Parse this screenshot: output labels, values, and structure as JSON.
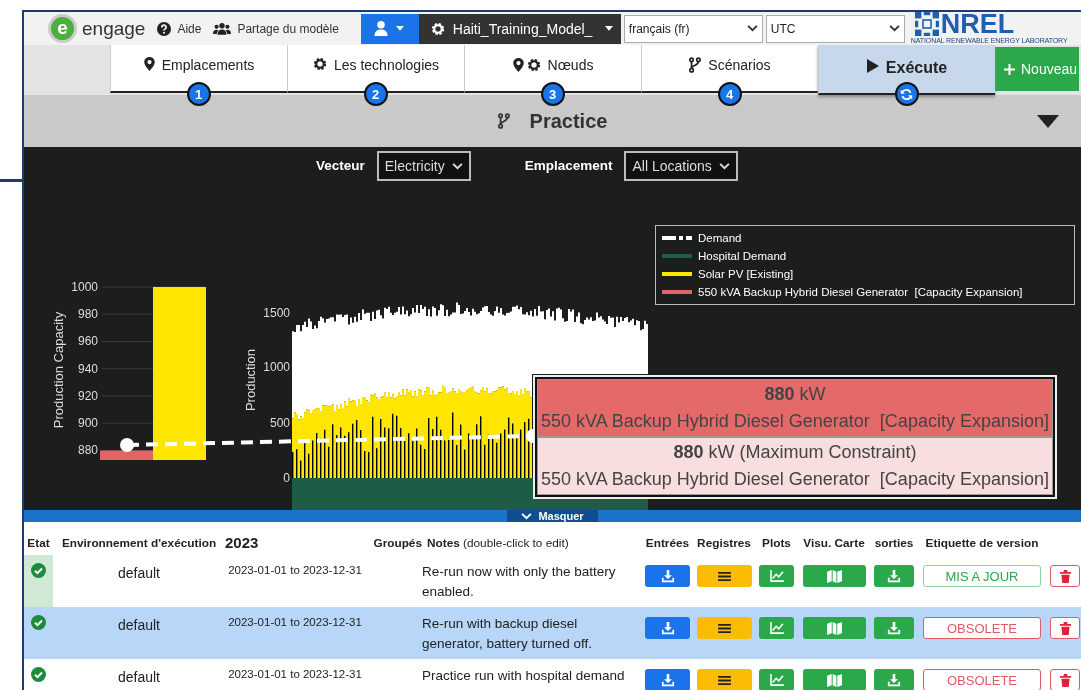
{
  "header": {
    "logo_letter": "e",
    "logo_text": "engage",
    "links": [
      {
        "label": "Aide"
      },
      {
        "label": "Partage du modèle"
      }
    ],
    "model": "Haiti_Training_Model_",
    "language": "français (fr)",
    "timezone": "UTC",
    "brand": "NREL",
    "brand_subtitle": "NATIONAL RENEWABLE ENERGY LABORATORY"
  },
  "nav": {
    "tabs": [
      {
        "label": "Emplacements",
        "badge": "1",
        "kind": "step",
        "selected": false
      },
      {
        "label": "Les technologies",
        "badge": "2",
        "kind": "step",
        "selected": false
      },
      {
        "label": "Nœuds",
        "badge": "3",
        "kind": "step",
        "selected": false
      },
      {
        "label": "Scénarios",
        "badge": "4",
        "kind": "step",
        "selected": false
      },
      {
        "label": "Exécute",
        "kind": "run",
        "selected": true
      }
    ],
    "new_button": "Nouveau"
  },
  "scenario": {
    "title": "Practice"
  },
  "filters": [
    {
      "label": "Vecteur",
      "value": "Electricity"
    },
    {
      "label": "Emplacement",
      "value": "All Locations"
    }
  ],
  "capacity_chart": {
    "chart_data": {
      "type": "bar",
      "ylabel": "Production Capacity",
      "ylim": [
        873,
        1000
      ],
      "yticks": [
        880,
        900,
        920,
        940,
        960,
        980,
        1000
      ],
      "grid": true,
      "series": [
        {
          "color": "#e06666",
          "values": [
            880
          ]
        },
        {
          "color": "#ffe600",
          "values": [
            1000
          ]
        }
      ]
    }
  },
  "production_chart": {
    "ylabel": "Production",
    "yticks": [
      "1500",
      "1000",
      "500",
      "0"
    ]
  },
  "legend": [
    {
      "label": "Demand",
      "color": "#ffffff",
      "kind": "dash"
    },
    {
      "label": "Hospital Demand",
      "color": "#1e5c46",
      "kind": "solid"
    },
    {
      "label": "Solar PV [Existing]",
      "color": "#ffe600",
      "kind": "solid"
    },
    {
      "label": "550 kVA Backup Hybrid Diesel Generator  [Capacity Expansion]",
      "color": "#e06666",
      "kind": "solid"
    }
  ],
  "tooltip": [
    {
      "value": "**880** kW",
      "series": "550 kVA Backup Hybrid Diesel Generator  [Capacity Expansion]",
      "color": "#e46a6a"
    },
    {
      "value": "**880** kW (Maximum Constraint)",
      "series": "550 kVA Backup Hybrid Diesel Generator  [Capacity Expansion]",
      "color": "#f8dede"
    }
  ],
  "collapse_label": "Masquer",
  "table": {
    "columns": [
      "Etat",
      "Environnement d'exécution",
      "2023",
      "Groupés",
      "**Notes** (double-click to edit)",
      "Entrées",
      "Registres",
      "Plots",
      "Visu. Carte",
      "sorties",
      "Etiquette de version"
    ],
    "rows": [
      {
        "status_ok": true,
        "status_highlight": true,
        "selected": false,
        "environment": "default",
        "period": "2023-01-01 to 2023-12-31",
        "notes": "Re-run now with only the battery enabled.",
        "version": {
          "label": "MIS A JOUR",
          "kind": "current"
        }
      },
      {
        "status_ok": true,
        "status_highlight": false,
        "selected": true,
        "environment": "default",
        "period": "2023-01-01 to 2023-12-31",
        "notes": "Re-run with backup diesel generator, battery turned off.",
        "version": {
          "label": "OBSOLETE",
          "kind": "obsolete"
        }
      },
      {
        "status_ok": true,
        "status_highlight": false,
        "selected": false,
        "environment": "default",
        "period": "2023-01-01 to 2023-12-31",
        "notes": "Practice run with hospital demand",
        "version": {
          "label": "OBSOLETE",
          "kind": "obsolete"
        }
      }
    ]
  }
}
